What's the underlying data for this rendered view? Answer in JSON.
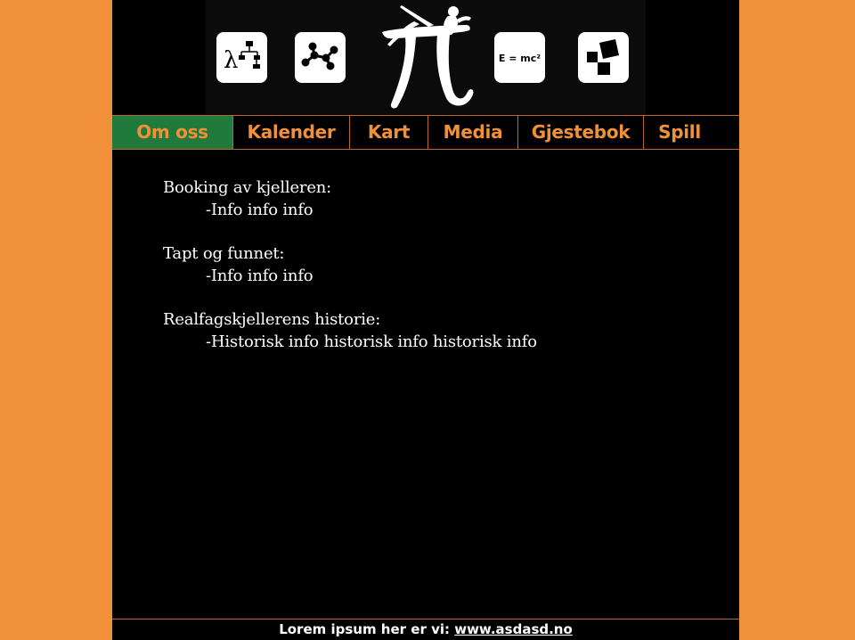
{
  "nav": {
    "tabs": [
      {
        "label": "Om oss",
        "active": true
      },
      {
        "label": "Kalender"
      },
      {
        "label": "Kart"
      },
      {
        "label": "Media"
      },
      {
        "label": "Gjestebok"
      },
      {
        "label": "Spill"
      }
    ]
  },
  "banner": {
    "icons": [
      "lambda-hierarchy-icon",
      "graph-nodes-icon",
      "pi-pinup-logo",
      "emc2-icon",
      "pythagoras-squares-icon"
    ],
    "emc2_text": "E = mc²",
    "lambda_text": "λ"
  },
  "content": {
    "sections": [
      {
        "heading": "Booking av kjelleren:",
        "body": "-Info info info"
      },
      {
        "heading": "Tapt og funnet:",
        "body": "-Info info info"
      },
      {
        "heading": "Realfagskjellerens historie:",
        "body": "-Historisk info historisk info historisk info"
      }
    ]
  },
  "footer": {
    "text": "Lorem ipsum her er vi: ",
    "link": "www.asdasd.no"
  },
  "colors": {
    "background": "#f0913a",
    "page": "#000000",
    "nav_text": "#f0913a",
    "active_tab": "#1f7a3b",
    "divider": "#c0662b"
  }
}
